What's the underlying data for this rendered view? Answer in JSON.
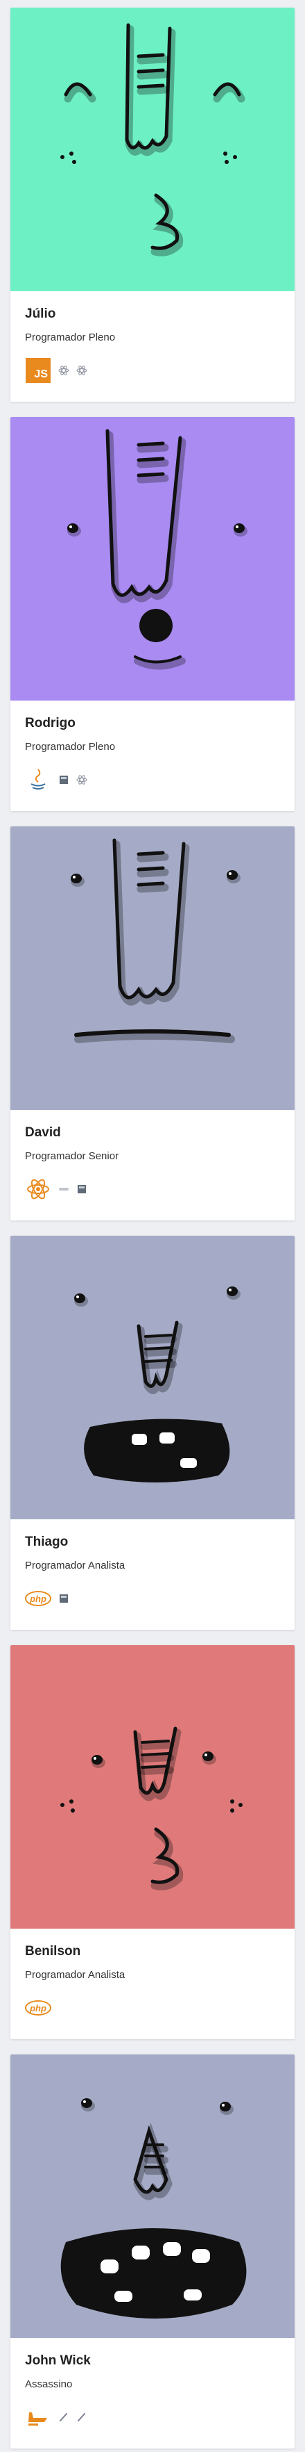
{
  "colors": {
    "page_background": "#eeeff3",
    "card_background": "#ffffff",
    "accent_orange": "#e98a1e"
  },
  "profiles": [
    {
      "name": "Júlio",
      "role": "Programador Pleno",
      "avatar_background": "#6ef0c5",
      "avatar_style": "nose-lashes-dots-curl",
      "primary_skill": {
        "icon": "javascript-icon",
        "label": "JS"
      },
      "secondary_skills": [
        "react-icon",
        "react-icon"
      ]
    },
    {
      "name": "Rodrigo",
      "role": "Programador Pleno",
      "avatar_background": "#a98bf2",
      "avatar_style": "nose-round-mouth",
      "primary_skill": {
        "icon": "java-icon",
        "label": ""
      },
      "secondary_skills": [
        "database-icon",
        "react-icon"
      ]
    },
    {
      "name": "David",
      "role": "Programador Senior",
      "avatar_background": "#a5abc6",
      "avatar_style": "nose-flat-mouth",
      "primary_skill": {
        "icon": "react-icon",
        "label": ""
      },
      "secondary_skills": [
        "dash-icon",
        "database-icon"
      ]
    },
    {
      "name": "Thiago",
      "role": "Programador Analista",
      "avatar_background": "#a5abc6",
      "avatar_style": "short-nose-open-mouth",
      "primary_skill": {
        "icon": "php-icon",
        "label": "php"
      },
      "secondary_skills": [
        "database-icon"
      ]
    },
    {
      "name": "Benilson",
      "role": "Programador Analista",
      "avatar_background": "#e07a7a",
      "avatar_style": "short-nose-curl",
      "primary_skill": {
        "icon": "php-icon",
        "label": "php"
      },
      "secondary_skills": []
    },
    {
      "name": "John Wick",
      "role": "Assassino",
      "avatar_background": "#a5abc6",
      "avatar_style": "pointed-nose-big-mouth",
      "primary_skill": {
        "icon": "gun-icon",
        "label": ""
      },
      "secondary_skills": [
        "knife-icon",
        "knife-icon"
      ]
    }
  ]
}
